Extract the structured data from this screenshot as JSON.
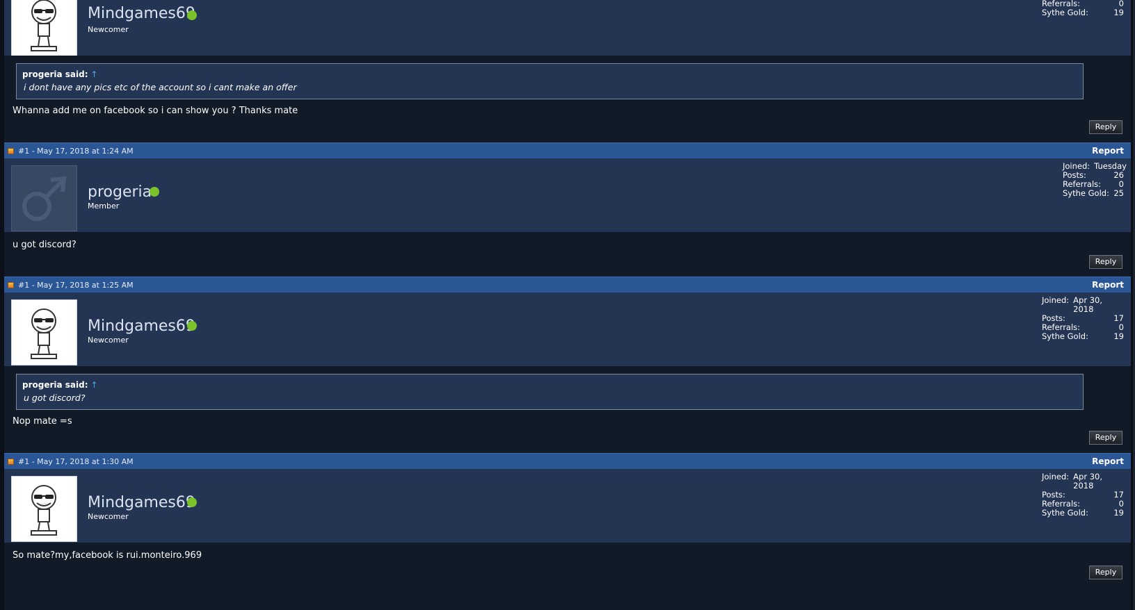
{
  "posts": [
    {
      "username": "Mindgames69",
      "rank": "Newcomer",
      "avatar": "troll-face-avatar",
      "stats": {
        "referrals_label": "Referrals:",
        "referrals": "0",
        "gold_label": "Sythe Gold:",
        "gold": "19"
      },
      "quote": {
        "author": "progeria said:",
        "arrow": "↑",
        "text": "i dont have any pics etc of the account so i cant make an offer"
      },
      "message": "Whanna add me on facebook so i can show you ? Thanks mate",
      "reply_label": "Reply"
    },
    {
      "meta": "#1 - May 17, 2018 at 1:24 AM",
      "report_label": "Report",
      "username": "progeria",
      "rank": "Member",
      "avatar": "male-symbol-avatar",
      "stats": {
        "joined_label": "Joined:",
        "joined": "Tuesday",
        "posts_label": "Posts:",
        "posts": "26",
        "referrals_label": "Referrals:",
        "referrals": "0",
        "gold_label": "Sythe Gold:",
        "gold": "25"
      },
      "message": "u got discord?",
      "reply_label": "Reply"
    },
    {
      "meta": "#1 - May 17, 2018 at 1:25 AM",
      "report_label": "Report",
      "username": "Mindgames69",
      "rank": "Newcomer",
      "avatar": "troll-face-avatar",
      "stats": {
        "joined_label": "Joined:",
        "joined": "Apr 30, 2018",
        "posts_label": "Posts:",
        "posts": "17",
        "referrals_label": "Referrals:",
        "referrals": "0",
        "gold_label": "Sythe Gold:",
        "gold": "19"
      },
      "quote": {
        "author": "progeria said:",
        "arrow": "↑",
        "text": "u got discord?"
      },
      "message": "Nop mate =s",
      "reply_label": "Reply"
    },
    {
      "meta": "#1 - May 17, 2018 at 1:30 AM",
      "report_label": "Report",
      "username": "Mindgames69",
      "rank": "Newcomer",
      "avatar": "troll-face-avatar",
      "stats": {
        "joined_label": "Joined:",
        "joined": "Apr 30, 2018",
        "posts_label": "Posts:",
        "posts": "17",
        "referrals_label": "Referrals:",
        "referrals": "0",
        "gold_label": "Sythe Gold:",
        "gold": "19"
      },
      "message": "So mate?my,facebook is rui.monteiro.969",
      "reply_label": "Reply"
    }
  ],
  "colors": {
    "bar": "#2b5695",
    "header": "#243553",
    "body": "#111a27",
    "online": "#7ac22a"
  }
}
